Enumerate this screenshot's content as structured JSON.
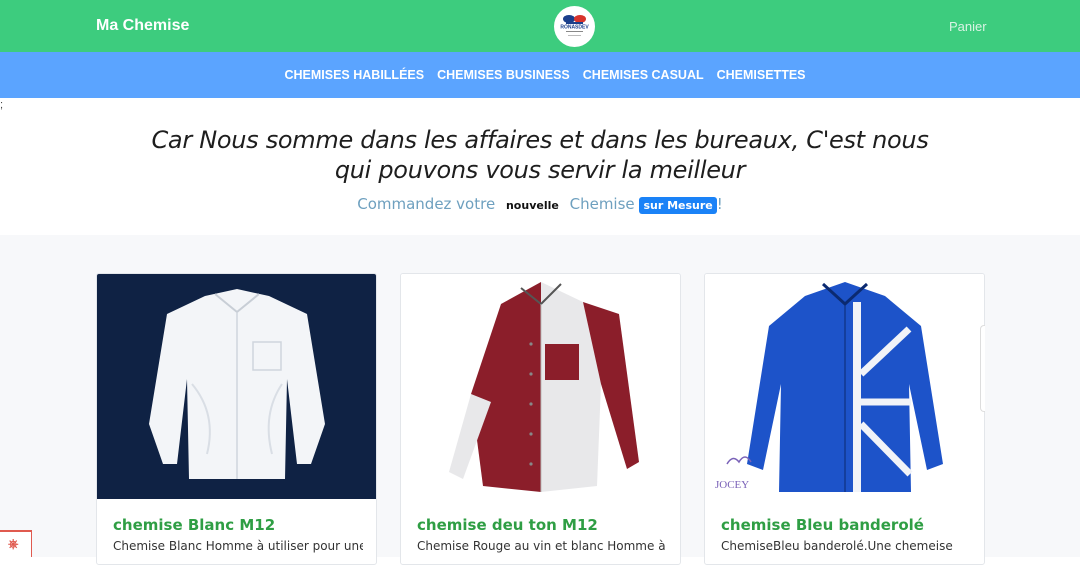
{
  "header": {
    "brand": "Ma Chemise",
    "logo_text": "RONASDEV",
    "cart_label": "Panier"
  },
  "categories": [
    "CHEMISES HABILLÉES",
    "CHEMISES BUSINESS",
    "CHEMISES CASUAL",
    "CHEMISETTES"
  ],
  "stray_char": ";",
  "hero": {
    "headline": "Car Nous somme dans les affaires et dans les bureaux, C'est nous qui pouvons vous servir la meilleur",
    "tag_prefix": "Commandez votre",
    "tag_new": "nouvelle",
    "tag_middle": "Chemise",
    "tag_badge": "sur Mesure",
    "tag_suffix": "!"
  },
  "products": [
    {
      "title": "chemise Blanc M12",
      "desc": "Chemise Blanc Homme à utiliser pour une"
    },
    {
      "title": "chemise deu ton M12",
      "desc": "Chemise Rouge au vin et blanc Homme à"
    },
    {
      "title": "chemise Bleu banderolé",
      "desc": "ChemiseBleu banderolé.Une chemeise"
    }
  ],
  "watermark": "JOCEY",
  "corner_icon": "laravel-icon",
  "colors": {
    "topbar": "#3dcc7e",
    "catbar": "#5ba4ff",
    "title_green": "#2f9e44",
    "badge_blue": "#1a82f7"
  }
}
